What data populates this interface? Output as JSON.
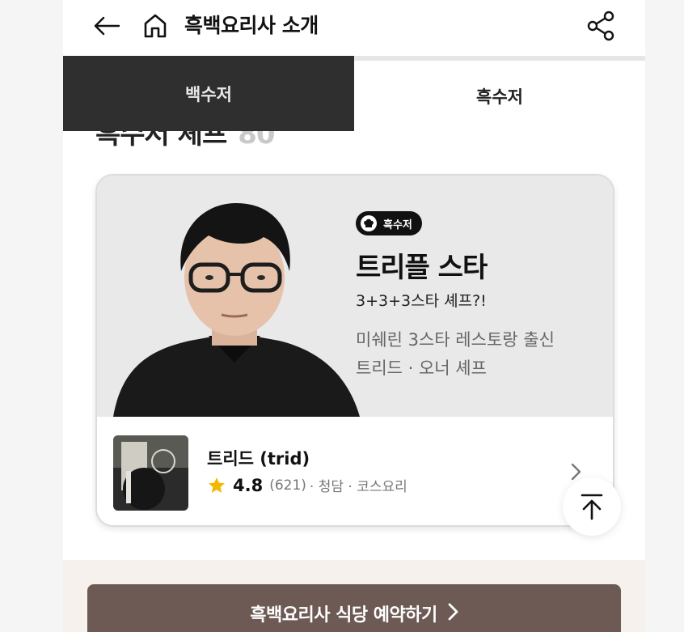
{
  "header": {
    "title": "흑백요리사 소개",
    "back_icon": "arrow-left-icon",
    "home_icon": "home-icon",
    "share_icon": "share-icon"
  },
  "tabs": [
    {
      "label": "백수저",
      "active": true
    },
    {
      "label": "흑수저",
      "active": false
    }
  ],
  "section": {
    "title": "흑수저 셰프",
    "count": "80"
  },
  "chef_card": {
    "badge": "흑수저",
    "name": "트리플 스타",
    "tagline": "3+3+3스타 셰프?!",
    "desc_line1": "미쉐린 3스타 레스토랑 출신",
    "desc_line2": "트리드 · 오너 셰프",
    "restaurant": {
      "name": "트리드 (trid)",
      "rating": "4.8",
      "reviews": "(621)",
      "meta": "· 청담 · 코스요리"
    }
  },
  "cta": {
    "label": "흑백요리사 식당 예약하기"
  },
  "colors": {
    "tab_active_bg": "#2f2f2f",
    "cta_bg": "#6d5a55",
    "star": "#f5b800"
  }
}
